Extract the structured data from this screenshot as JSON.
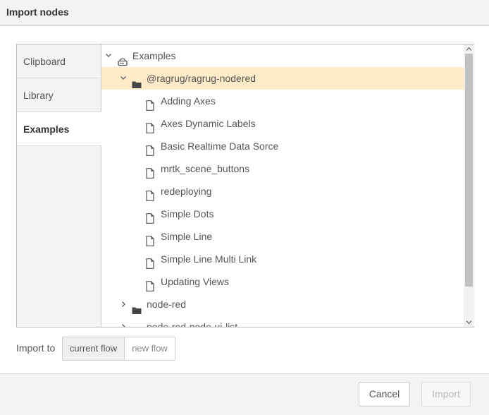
{
  "dialog": {
    "title": "Import nodes"
  },
  "tabs": [
    {
      "label": "Clipboard",
      "active": false
    },
    {
      "label": "Library",
      "active": false
    },
    {
      "label": "Examples",
      "active": true
    }
  ],
  "tree": {
    "root": {
      "label": "Examples",
      "icon": "drive-icon",
      "expanded": true
    },
    "group": {
      "label": "@ragrug/ragrug-nodered",
      "icon": "folder-icon",
      "expanded": true,
      "selected": true
    },
    "files": [
      {
        "label": "Adding Axes",
        "icon": "file-icon"
      },
      {
        "label": "Axes Dynamic Labels",
        "icon": "file-icon"
      },
      {
        "label": "Basic Realtime Data Sorce",
        "icon": "file-icon"
      },
      {
        "label": "mrtk_scene_buttons",
        "icon": "file-icon"
      },
      {
        "label": "redeploying",
        "icon": "file-icon"
      },
      {
        "label": "Simple Dots",
        "icon": "file-icon"
      },
      {
        "label": "Simple Line",
        "icon": "file-icon"
      },
      {
        "label": "Simple Line Multi Link",
        "icon": "file-icon"
      },
      {
        "label": "Updating Views",
        "icon": "file-icon"
      }
    ],
    "collapsed_groups": [
      {
        "label": "node-red",
        "icon": "folder-icon",
        "expanded": false
      },
      {
        "label": "node-red-node-ui-list",
        "icon": "folder-icon",
        "expanded": false
      }
    ]
  },
  "import_to": {
    "label": "Import to",
    "options": [
      "current flow",
      "new flow"
    ],
    "selected": "current flow"
  },
  "footer": {
    "cancel_label": "Cancel",
    "import_label": "Import",
    "import_enabled": false
  },
  "colors": {
    "selected_row": "#ffebc7",
    "panel_bg": "#f3f3f3"
  }
}
